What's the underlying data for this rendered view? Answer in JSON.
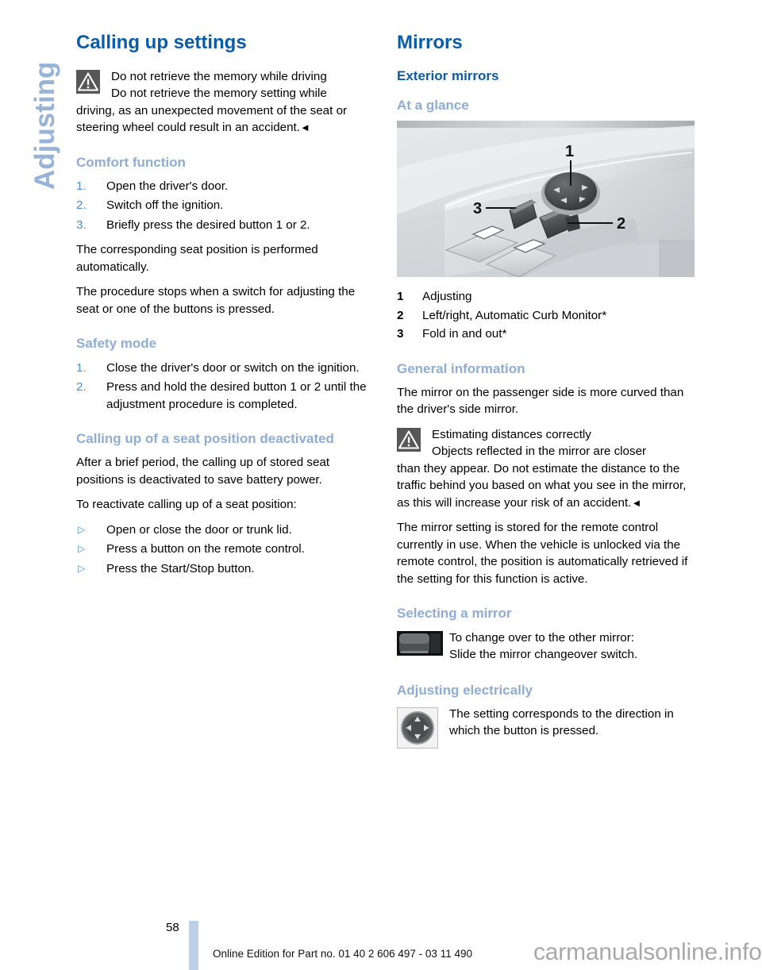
{
  "chapter_tab": {
    "label": "Adjusting"
  },
  "colors": {
    "heading_dark_blue": "#0b5ca8",
    "heading_light_blue": "#8fadd4",
    "list_marker_blue": "#4a8fcf",
    "chapter_tab_blue": "#97b3d8",
    "page_bar_blue": "#bfcfe8",
    "warning_icon_bg": "#575757"
  },
  "left_column": {
    "title": "Calling up settings",
    "warning": {
      "icon": "warning-triangle-icon",
      "headline": "Do not retrieve the memory while driving",
      "body_first": "Do not retrieve the memory setting while",
      "body_rest": "driving, as an unexpected movement of the seat or steering wheel could result in an accident.",
      "end_marker": "◄"
    },
    "comfort_function": {
      "heading": "Comfort function",
      "steps": [
        {
          "num": "1.",
          "text": "Open the driver's door."
        },
        {
          "num": "2.",
          "text": "Switch off the ignition."
        },
        {
          "num": "3.",
          "text": "Briefly press the desired button 1 or 2."
        }
      ],
      "paragraphs": [
        "The corresponding seat position is performed automatically.",
        "The procedure stops when a switch for adjusting the seat or one of the buttons is pressed."
      ]
    },
    "safety_mode": {
      "heading": "Safety mode",
      "steps": [
        {
          "num": "1.",
          "text": "Close the driver's door or switch on the ignition."
        },
        {
          "num": "2.",
          "text": "Press and hold the desired button 1 or 2 until the adjustment procedure is completed."
        }
      ]
    },
    "deactivated": {
      "heading": "Calling up of a seat position deactivated",
      "paragraphs": [
        "After a brief period, the calling up of stored seat positions is deactivated to save battery power.",
        "To reactivate calling up of a seat position:"
      ],
      "bullets": [
        "Open or close the door or trunk lid.",
        "Press a button on the remote control.",
        "Press the Start/Stop button."
      ],
      "bullet_marker": "▷"
    }
  },
  "right_column": {
    "title": "Mirrors",
    "subtitle": "Exterior mirrors",
    "at_a_glance": {
      "heading": "At a glance",
      "figure": {
        "name": "door-panel-mirror-controls-photo",
        "callouts": [
          "1",
          "2",
          "3"
        ]
      },
      "legend": [
        {
          "num": "1",
          "text": "Adjusting"
        },
        {
          "num": "2",
          "text": "Left/right, Automatic Curb Monitor*"
        },
        {
          "num": "3",
          "text": "Fold in and out*"
        }
      ]
    },
    "general_information": {
      "heading": "General information",
      "intro": "The mirror on the passenger side is more curved than the driver's side mirror.",
      "warning": {
        "icon": "warning-triangle-icon",
        "headline": "Estimating distances correctly",
        "body_first": "Objects reflected in the mirror are closer",
        "body_rest": "than they appear. Do not estimate the distance to the traffic behind you based on what you see in the mirror, as this will increase your risk of an accident.",
        "end_marker": "◄"
      },
      "closing": "The mirror setting is stored for the remote control currently in use. When the vehicle is unlocked via the remote control, the position is automatically retrieved if the setting for this function is active."
    },
    "selecting_a_mirror": {
      "heading": "Selecting a mirror",
      "icon": "mirror-changeover-switch-icon",
      "line1": "To change over to the other mirror:",
      "line2": "Slide the mirror changeover switch."
    },
    "adjusting_electrically": {
      "heading": "Adjusting electrically",
      "icon": "four-way-adjuster-button-icon",
      "text": "The setting corresponds to the direction in which the button is pressed."
    }
  },
  "footer": {
    "page_number": "58",
    "note": "Online Edition for Part no. 01 40 2 606 497 - 03 11 490",
    "watermark": "carmanualsonline.info"
  }
}
